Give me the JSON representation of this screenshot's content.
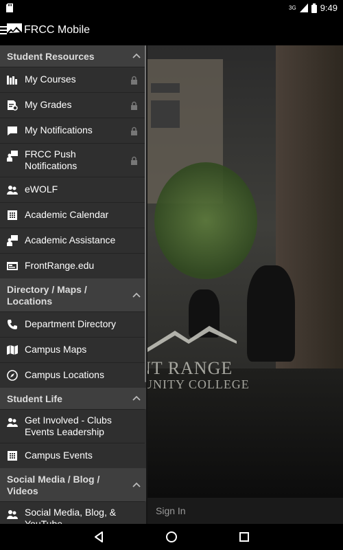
{
  "status_bar": {
    "signal": "3G",
    "time": "9:49"
  },
  "app_bar": {
    "title": "FRCC Mobile"
  },
  "background": {
    "college_line1": "NT RANGE",
    "college_line2": "UNITY COLLEGE",
    "sign_in": "Sign In"
  },
  "drawer": {
    "sections": [
      {
        "label": "Student Resources",
        "items": [
          {
            "label": "My Courses",
            "icon": "courses-icon",
            "locked": true
          },
          {
            "label": "My Grades",
            "icon": "grades-icon",
            "locked": true
          },
          {
            "label": "My Notifications",
            "icon": "chat-bubble-icon",
            "locked": true
          },
          {
            "label": "FRCC Push Notifications",
            "icon": "person-board-icon",
            "locked": true
          },
          {
            "label": "eWOLF",
            "icon": "people-icon",
            "locked": false
          },
          {
            "label": "Academic Calendar",
            "icon": "calendar-grid-icon",
            "locked": false
          },
          {
            "label": "Academic Assistance",
            "icon": "person-board-icon",
            "locked": false
          },
          {
            "label": "FrontRange.edu",
            "icon": "website-icon",
            "locked": false
          }
        ]
      },
      {
        "label": "Directory / Maps / Locations",
        "items": [
          {
            "label": "Department Directory",
            "icon": "phone-icon"
          },
          {
            "label": "Campus Maps",
            "icon": "map-icon"
          },
          {
            "label": "Campus Locations",
            "icon": "compass-icon"
          }
        ]
      },
      {
        "label": "Student Life",
        "items": [
          {
            "label": "Get Involved - Clubs Events Leadership",
            "icon": "people-icon"
          },
          {
            "label": "Campus Events",
            "icon": "calendar-grid-icon"
          }
        ]
      },
      {
        "label": "Social Media / Blog / Videos",
        "items": [
          {
            "label": "Social Media, Blog, & YouTube",
            "icon": "people-icon"
          }
        ]
      }
    ]
  }
}
